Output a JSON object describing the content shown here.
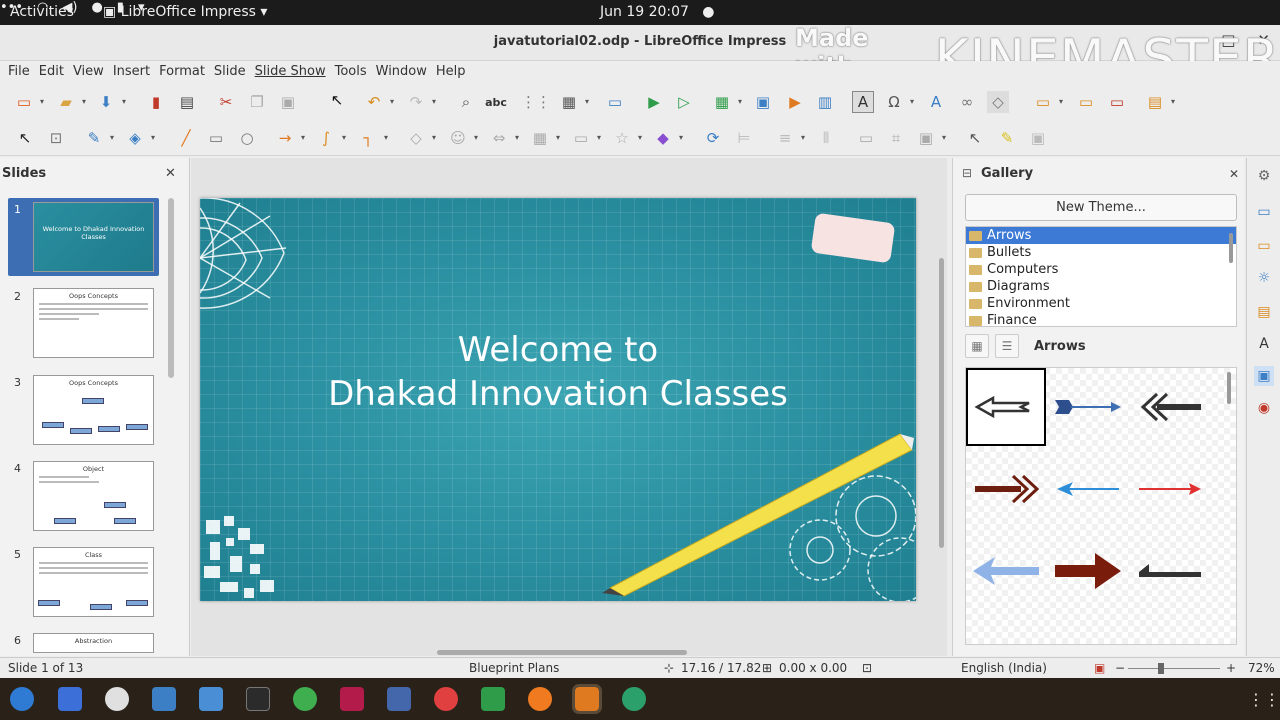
{
  "system_bar": {
    "activities": "Activities",
    "app_name": "LibreOffice Impress",
    "clock": "Jun 19  20:07"
  },
  "window": {
    "title": "javatutorial02.odp - LibreOffice Impress"
  },
  "watermark": {
    "prefix": "Made with",
    "brand": "KINEMASTER"
  },
  "menu": [
    "File",
    "Edit",
    "View",
    "Insert",
    "Format",
    "Slide",
    "Slide Show",
    "Tools",
    "Window",
    "Help"
  ],
  "slides_pane": {
    "title": "Slides",
    "slides": [
      {
        "num": "1",
        "title": "Welcome to Dhakad Innovation Classes"
      },
      {
        "num": "2",
        "title": "Oops Concepts"
      },
      {
        "num": "3",
        "title": "Oops Concepts"
      },
      {
        "num": "4",
        "title": "Object"
      },
      {
        "num": "5",
        "title": "Class"
      },
      {
        "num": "6",
        "title": "Abstraction"
      }
    ]
  },
  "slide": {
    "line1": "Welcome to",
    "line2": "Dhakad Innovation Classes"
  },
  "gallery": {
    "title": "Gallery",
    "new_theme": "New Theme...",
    "themes": [
      "Arrows",
      "Bullets",
      "Computers",
      "Diagrams",
      "Environment",
      "Finance"
    ],
    "selected_theme": "Arrows"
  },
  "status": {
    "slide_count": "Slide 1 of 13",
    "master": "Blueprint Plans",
    "position": "17.16 / 17.82",
    "size": "0.00 x 0.00",
    "language": "English (India)",
    "zoom": "72%"
  },
  "colors": {
    "slide_bg": "#2a8fa0",
    "selection": "#3d7ad6",
    "top_bar": "#1b1b1b"
  }
}
